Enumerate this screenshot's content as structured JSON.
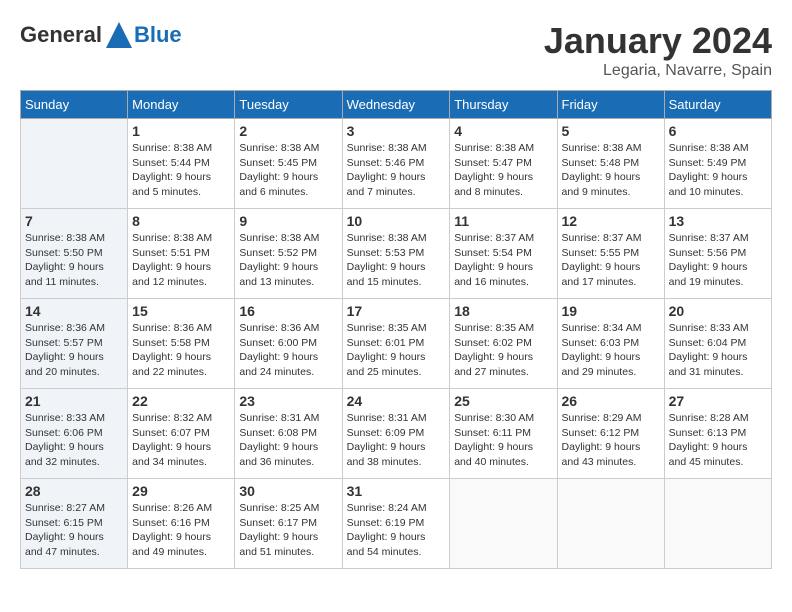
{
  "logo": {
    "general": "General",
    "blue": "Blue"
  },
  "header": {
    "month": "January 2024",
    "location": "Legaria, Navarre, Spain"
  },
  "weekdays": [
    "Sunday",
    "Monday",
    "Tuesday",
    "Wednesday",
    "Thursday",
    "Friday",
    "Saturday"
  ],
  "weeks": [
    [
      {
        "day": "",
        "info": ""
      },
      {
        "day": "1",
        "info": "Sunrise: 8:38 AM\nSunset: 5:44 PM\nDaylight: 9 hours\nand 5 minutes."
      },
      {
        "day": "2",
        "info": "Sunrise: 8:38 AM\nSunset: 5:45 PM\nDaylight: 9 hours\nand 6 minutes."
      },
      {
        "day": "3",
        "info": "Sunrise: 8:38 AM\nSunset: 5:46 PM\nDaylight: 9 hours\nand 7 minutes."
      },
      {
        "day": "4",
        "info": "Sunrise: 8:38 AM\nSunset: 5:47 PM\nDaylight: 9 hours\nand 8 minutes."
      },
      {
        "day": "5",
        "info": "Sunrise: 8:38 AM\nSunset: 5:48 PM\nDaylight: 9 hours\nand 9 minutes."
      },
      {
        "day": "6",
        "info": "Sunrise: 8:38 AM\nSunset: 5:49 PM\nDaylight: 9 hours\nand 10 minutes."
      }
    ],
    [
      {
        "day": "7",
        "info": "Sunrise: 8:38 AM\nSunset: 5:50 PM\nDaylight: 9 hours\nand 11 minutes."
      },
      {
        "day": "8",
        "info": "Sunrise: 8:38 AM\nSunset: 5:51 PM\nDaylight: 9 hours\nand 12 minutes."
      },
      {
        "day": "9",
        "info": "Sunrise: 8:38 AM\nSunset: 5:52 PM\nDaylight: 9 hours\nand 13 minutes."
      },
      {
        "day": "10",
        "info": "Sunrise: 8:38 AM\nSunset: 5:53 PM\nDaylight: 9 hours\nand 15 minutes."
      },
      {
        "day": "11",
        "info": "Sunrise: 8:37 AM\nSunset: 5:54 PM\nDaylight: 9 hours\nand 16 minutes."
      },
      {
        "day": "12",
        "info": "Sunrise: 8:37 AM\nSunset: 5:55 PM\nDaylight: 9 hours\nand 17 minutes."
      },
      {
        "day": "13",
        "info": "Sunrise: 8:37 AM\nSunset: 5:56 PM\nDaylight: 9 hours\nand 19 minutes."
      }
    ],
    [
      {
        "day": "14",
        "info": "Sunrise: 8:36 AM\nSunset: 5:57 PM\nDaylight: 9 hours\nand 20 minutes."
      },
      {
        "day": "15",
        "info": "Sunrise: 8:36 AM\nSunset: 5:58 PM\nDaylight: 9 hours\nand 22 minutes."
      },
      {
        "day": "16",
        "info": "Sunrise: 8:36 AM\nSunset: 6:00 PM\nDaylight: 9 hours\nand 24 minutes."
      },
      {
        "day": "17",
        "info": "Sunrise: 8:35 AM\nSunset: 6:01 PM\nDaylight: 9 hours\nand 25 minutes."
      },
      {
        "day": "18",
        "info": "Sunrise: 8:35 AM\nSunset: 6:02 PM\nDaylight: 9 hours\nand 27 minutes."
      },
      {
        "day": "19",
        "info": "Sunrise: 8:34 AM\nSunset: 6:03 PM\nDaylight: 9 hours\nand 29 minutes."
      },
      {
        "day": "20",
        "info": "Sunrise: 8:33 AM\nSunset: 6:04 PM\nDaylight: 9 hours\nand 31 minutes."
      }
    ],
    [
      {
        "day": "21",
        "info": "Sunrise: 8:33 AM\nSunset: 6:06 PM\nDaylight: 9 hours\nand 32 minutes."
      },
      {
        "day": "22",
        "info": "Sunrise: 8:32 AM\nSunset: 6:07 PM\nDaylight: 9 hours\nand 34 minutes."
      },
      {
        "day": "23",
        "info": "Sunrise: 8:31 AM\nSunset: 6:08 PM\nDaylight: 9 hours\nand 36 minutes."
      },
      {
        "day": "24",
        "info": "Sunrise: 8:31 AM\nSunset: 6:09 PM\nDaylight: 9 hours\nand 38 minutes."
      },
      {
        "day": "25",
        "info": "Sunrise: 8:30 AM\nSunset: 6:11 PM\nDaylight: 9 hours\nand 40 minutes."
      },
      {
        "day": "26",
        "info": "Sunrise: 8:29 AM\nSunset: 6:12 PM\nDaylight: 9 hours\nand 43 minutes."
      },
      {
        "day": "27",
        "info": "Sunrise: 8:28 AM\nSunset: 6:13 PM\nDaylight: 9 hours\nand 45 minutes."
      }
    ],
    [
      {
        "day": "28",
        "info": "Sunrise: 8:27 AM\nSunset: 6:15 PM\nDaylight: 9 hours\nand 47 minutes."
      },
      {
        "day": "29",
        "info": "Sunrise: 8:26 AM\nSunset: 6:16 PM\nDaylight: 9 hours\nand 49 minutes."
      },
      {
        "day": "30",
        "info": "Sunrise: 8:25 AM\nSunset: 6:17 PM\nDaylight: 9 hours\nand 51 minutes."
      },
      {
        "day": "31",
        "info": "Sunrise: 8:24 AM\nSunset: 6:19 PM\nDaylight: 9 hours\nand 54 minutes."
      },
      {
        "day": "",
        "info": ""
      },
      {
        "day": "",
        "info": ""
      },
      {
        "day": "",
        "info": ""
      }
    ]
  ]
}
